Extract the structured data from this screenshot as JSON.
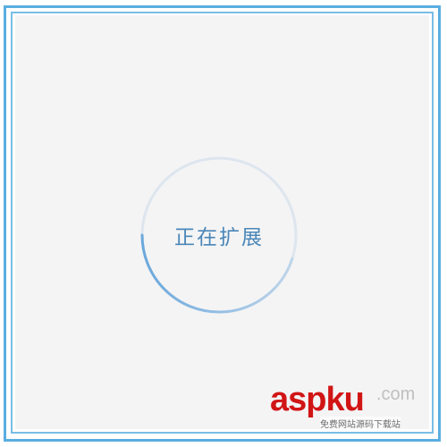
{
  "status": {
    "text": "正在扩展",
    "progress_percent": 45
  },
  "colors": {
    "frame": "#5aaee0",
    "screen_background": "#f4f4f5",
    "ring_track": "#dde5ee",
    "ring_progress": "#6aa8dc",
    "text": "#4b87b8",
    "watermark": "#d11515"
  },
  "watermark": {
    "brand": "aspku",
    "domain": ".com",
    "tagline": "免费网站源码下载站"
  }
}
